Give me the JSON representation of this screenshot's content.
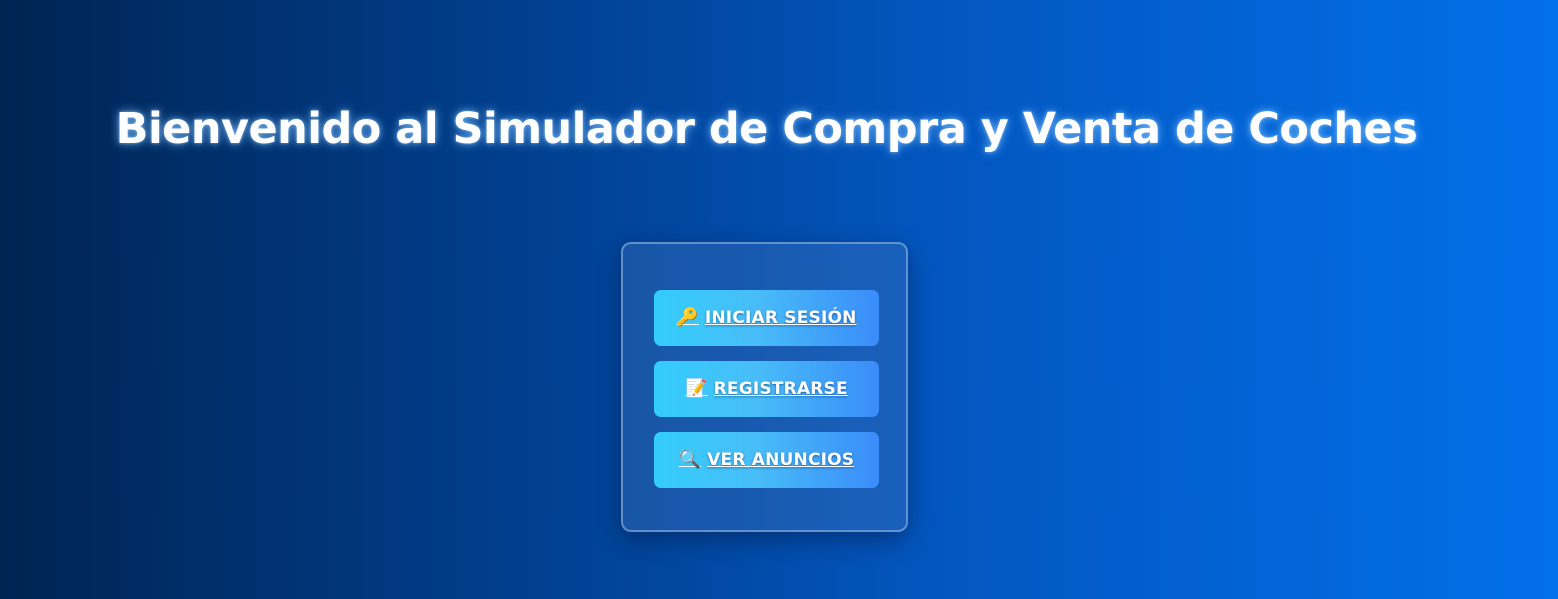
{
  "header": {
    "title": "Bienvenido al Simulador de Compra y Venta de Coches"
  },
  "menu": {
    "buttons": [
      {
        "icon": "key-icon",
        "emoji": "🔑",
        "label": "INICIAR SESIÓN"
      },
      {
        "icon": "memo-icon",
        "emoji": "📝",
        "label": "REGISTRARSE"
      },
      {
        "icon": "magnifier-icon",
        "emoji": "🔍",
        "label": "VER ANUNCIOS"
      }
    ]
  },
  "colors": {
    "background_start": "#002452",
    "background_end": "#0270ea",
    "button_start": "#33cdfb",
    "button_end": "#3a8cf9",
    "text": "#ffffff"
  }
}
